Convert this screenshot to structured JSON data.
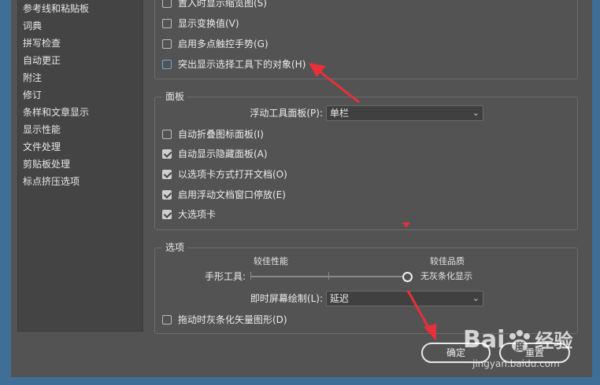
{
  "sidebar": {
    "items": [
      {
        "label": "参考线和粘贴板"
      },
      {
        "label": "词典"
      },
      {
        "label": "拼写检查"
      },
      {
        "label": "自动更正"
      },
      {
        "label": "附注"
      },
      {
        "label": "修订"
      },
      {
        "label": "条样和文章显示"
      },
      {
        "label": "显示性能"
      },
      {
        "label": "文件处理"
      },
      {
        "label": "剪贴板处理"
      },
      {
        "label": "标点挤压选项"
      }
    ]
  },
  "top_group": {
    "items": [
      {
        "label": "置入时显示缩览图(S)",
        "checked": false
      },
      {
        "label": "显示变换值(V)",
        "checked": false
      },
      {
        "label": "启用多点触控手势(G)",
        "checked": false
      },
      {
        "label": "突出显示选择工具下的对象(H)",
        "checked": false
      }
    ]
  },
  "panels_group": {
    "title": "面板",
    "floating_panel_label": "浮动工具面板(P):",
    "floating_panel_value": "单栏",
    "items": [
      {
        "label": "自动折叠图标面板(I)",
        "checked": false
      },
      {
        "label": "自动显示隐藏面板(A)",
        "checked": true
      },
      {
        "label": "以选项卡方式打开文档(O)",
        "checked": true
      },
      {
        "label": "启用浮动文档窗口停放(E)",
        "checked": true
      },
      {
        "label": "大选项卡",
        "checked": true
      }
    ]
  },
  "options_group": {
    "title": "选项",
    "hand_tool_label": "手形工具:",
    "better_performance": "较佳性能",
    "better_quality": "较佳品质",
    "no_greeking": "无灰条化显示",
    "live_redraw_label": "即时屏幕绘制(L):",
    "live_redraw_value": "延迟",
    "greek_vector_label": "拖动时灰条化矢量图形(D)",
    "greek_vector_checked": false
  },
  "buttons": {
    "ok": "确定",
    "reset": "重置"
  },
  "watermark": {
    "brand": "Bai",
    "brand_du": "度",
    "jingyan": "经验",
    "url": "jingyan.baidu.com"
  },
  "colors": {
    "background": "#535353",
    "annotation": "#e8303a",
    "frame": "#3f6f96"
  }
}
